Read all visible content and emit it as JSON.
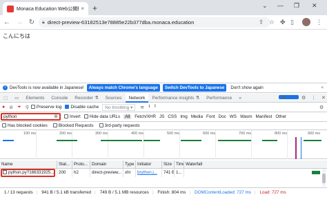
{
  "browser": {
    "tab_title": "Monaca Education Web公開機能",
    "tab_close": "×",
    "new_tab": "+",
    "url": "direct-preview-63182513e78885e22b377dba.monaca.education",
    "win_min": "⌄",
    "win_ctl_1": "—",
    "win_ctl_2": "❐",
    "win_ctl_3": "✕"
  },
  "page": {
    "text": "こんにちは"
  },
  "devtools": {
    "infobar": {
      "message": "DevTools is now available in Japanese!",
      "btn_match": "Always match Chrome's language",
      "btn_switch": "Switch DevTools to Japanese",
      "dont_show": "Don't show again",
      "close": "×"
    },
    "tabs": [
      "Elements",
      "Console",
      "Recorder ⚗",
      "Sources",
      "Network",
      "Performance insights ⚗",
      "Performance",
      "»"
    ],
    "active_tab": "Network",
    "issue_count": "1",
    "toolbar": {
      "preserve_log": "Preserve log",
      "disable_cache": "Disable cache",
      "throttle": "No throttling"
    },
    "filter": {
      "value": "python",
      "invert": "Invert",
      "hide_data_urls": "Hide data URLs",
      "types": [
        "All",
        "Fetch/XHR",
        "JS",
        "CSS",
        "Img",
        "Media",
        "Font",
        "Doc",
        "WS",
        "Wasm",
        "Manifest",
        "Other"
      ],
      "blocked_cookies": "Has blocked cookies",
      "blocked_requests": "Blocked Requests",
      "third_party": "3rd-party requests"
    },
    "timeline": {
      "ticks": [
        "100 ms",
        "200 ms",
        "300 ms",
        "400 ms",
        "500 ms",
        "600 ms",
        "700 ms",
        "800 ms",
        "900 ms"
      ]
    },
    "table": {
      "headers": [
        "Name",
        "Stat...",
        "Proto...",
        "Domain",
        "Type",
        "Initiator",
        "Size",
        "Time",
        "Waterfall"
      ],
      "rows": [
        [
          "python.py?166331925...",
          "200",
          "h2",
          "direct-preview...",
          "xhr",
          "brython.j...",
          "741 B",
          "1...",
          ""
        ]
      ]
    },
    "status": {
      "requests": "1 / 13 requests",
      "transferred": "941 B / 5.1 kB transferred",
      "resources": "749 B / 5.1 MB resources",
      "finish": "Finish: 804 ms",
      "dcl": "DOMContentLoaded: 727 ms",
      "load": "Load: 727 ms"
    }
  }
}
